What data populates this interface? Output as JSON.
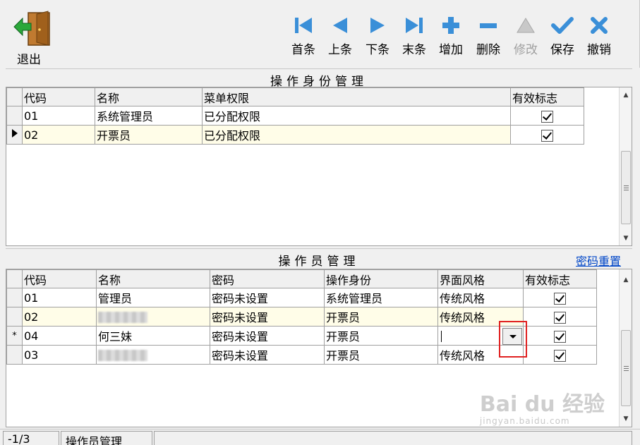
{
  "toolbar": {
    "exit_label": "退出",
    "buttons": [
      {
        "label": "首条",
        "icon": "first-icon",
        "enabled": true
      },
      {
        "label": "上条",
        "icon": "prev-icon",
        "enabled": true
      },
      {
        "label": "下条",
        "icon": "next-icon",
        "enabled": true
      },
      {
        "label": "末条",
        "icon": "last-icon",
        "enabled": true
      },
      {
        "label": "增加",
        "icon": "plus-icon",
        "enabled": true
      },
      {
        "label": "删除",
        "icon": "minus-icon",
        "enabled": true
      },
      {
        "label": "修改",
        "icon": "edit-icon",
        "enabled": false
      },
      {
        "label": "保存",
        "icon": "check-icon",
        "enabled": true
      },
      {
        "label": "撤销",
        "icon": "cancel-icon",
        "enabled": true
      }
    ]
  },
  "roles": {
    "title": "操作身份管理",
    "columns": [
      "代码",
      "名称",
      "菜单权限",
      "有效标志"
    ],
    "rows": [
      {
        "code": "01",
        "name": "系统管理员",
        "perm": "已分配权限",
        "valid": true
      },
      {
        "code": "02",
        "name": "开票员",
        "perm": "已分配权限",
        "valid": true
      }
    ]
  },
  "operators": {
    "title": "操作员管理",
    "reset_link": "密码重置",
    "columns": [
      "代码",
      "名称",
      "密码",
      "操作身份",
      "界面风格",
      "有效标志"
    ],
    "rows": [
      {
        "marker": "",
        "code": "01",
        "name": "管理员",
        "password": "密码未设置",
        "role": "系统管理员",
        "style": "传统风格",
        "valid": true
      },
      {
        "marker": "",
        "code": "02",
        "name": "",
        "password": "密码未设置",
        "role": "开票员",
        "style": "传统风格",
        "valid": true
      },
      {
        "marker": "*",
        "code": "04",
        "name": "何三妹",
        "password": "密码未设置",
        "role": "开票员",
        "style": "",
        "valid": true
      },
      {
        "marker": "",
        "code": "03",
        "name": "",
        "password": "密码未设置",
        "role": "开票员",
        "style": "传统风格",
        "valid": true
      }
    ]
  },
  "statusbar": {
    "position": "-1/3",
    "module": "操作员管理"
  },
  "watermark": {
    "main": "Bai du 经验",
    "sub": "jingyan.baidu.com"
  },
  "colors": {
    "icon_blue": "#3a8fd8",
    "selected_row": "#fffde8",
    "link": "#0046c8",
    "highlight_box": "#e02020"
  }
}
